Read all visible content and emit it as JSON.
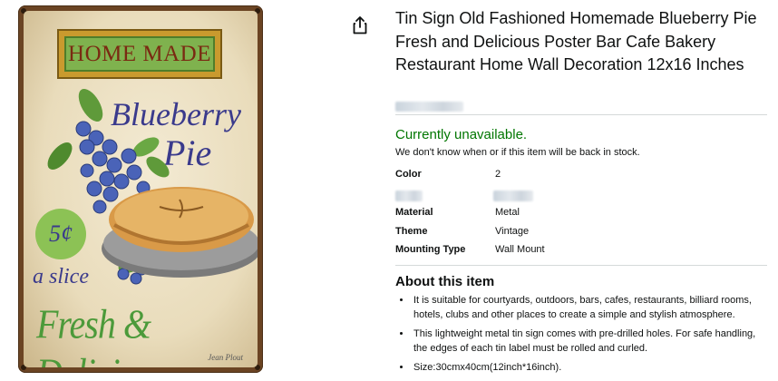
{
  "product": {
    "title": "Tin Sign Old Fashioned Homemade Blueberry Pie Fresh and Delicious Poster Bar Cafe Bakery Restaurant Home Wall Decoration 12x16 Inches",
    "availability": "Currently unavailable.",
    "stock_note": "We don't know when or if this item will be back in stock."
  },
  "image": {
    "banner_text": "HOME MADE",
    "title_line1": "Blueberry",
    "title_line2": "Pie",
    "price_badge": "5¢",
    "slice_text": "a slice",
    "tagline": "Fresh & Delicious",
    "signature": "Jean Plout",
    "colors": {
      "frame": "#6b4423",
      "banner": "#7fb24e",
      "text_blue": "#3a3a8c",
      "text_green": "#4c9a3a"
    }
  },
  "share": {
    "icon": "share-icon"
  },
  "specs": [
    {
      "key": "Color",
      "value": "2"
    },
    {
      "key": "Material",
      "value": "Metal"
    },
    {
      "key": "Theme",
      "value": "Vintage"
    },
    {
      "key": "Mounting Type",
      "value": "Wall Mount"
    }
  ],
  "about": {
    "heading": "About this item",
    "bullets": [
      "It is suitable for courtyards, outdoors, bars, cafes, restaurants, billiard rooms, hotels, clubs and other places to create a simple and stylish atmosphere.",
      "This lightweight metal tin sign comes with pre-drilled holes. For safe handling, the edges of each tin label must be rolled and curled.",
      "Size:30cmx40cm(12inch*16inch)."
    ]
  },
  "colors": {
    "availability": "#007600",
    "divider": "#d5d9d9",
    "text": "#0f1111"
  }
}
